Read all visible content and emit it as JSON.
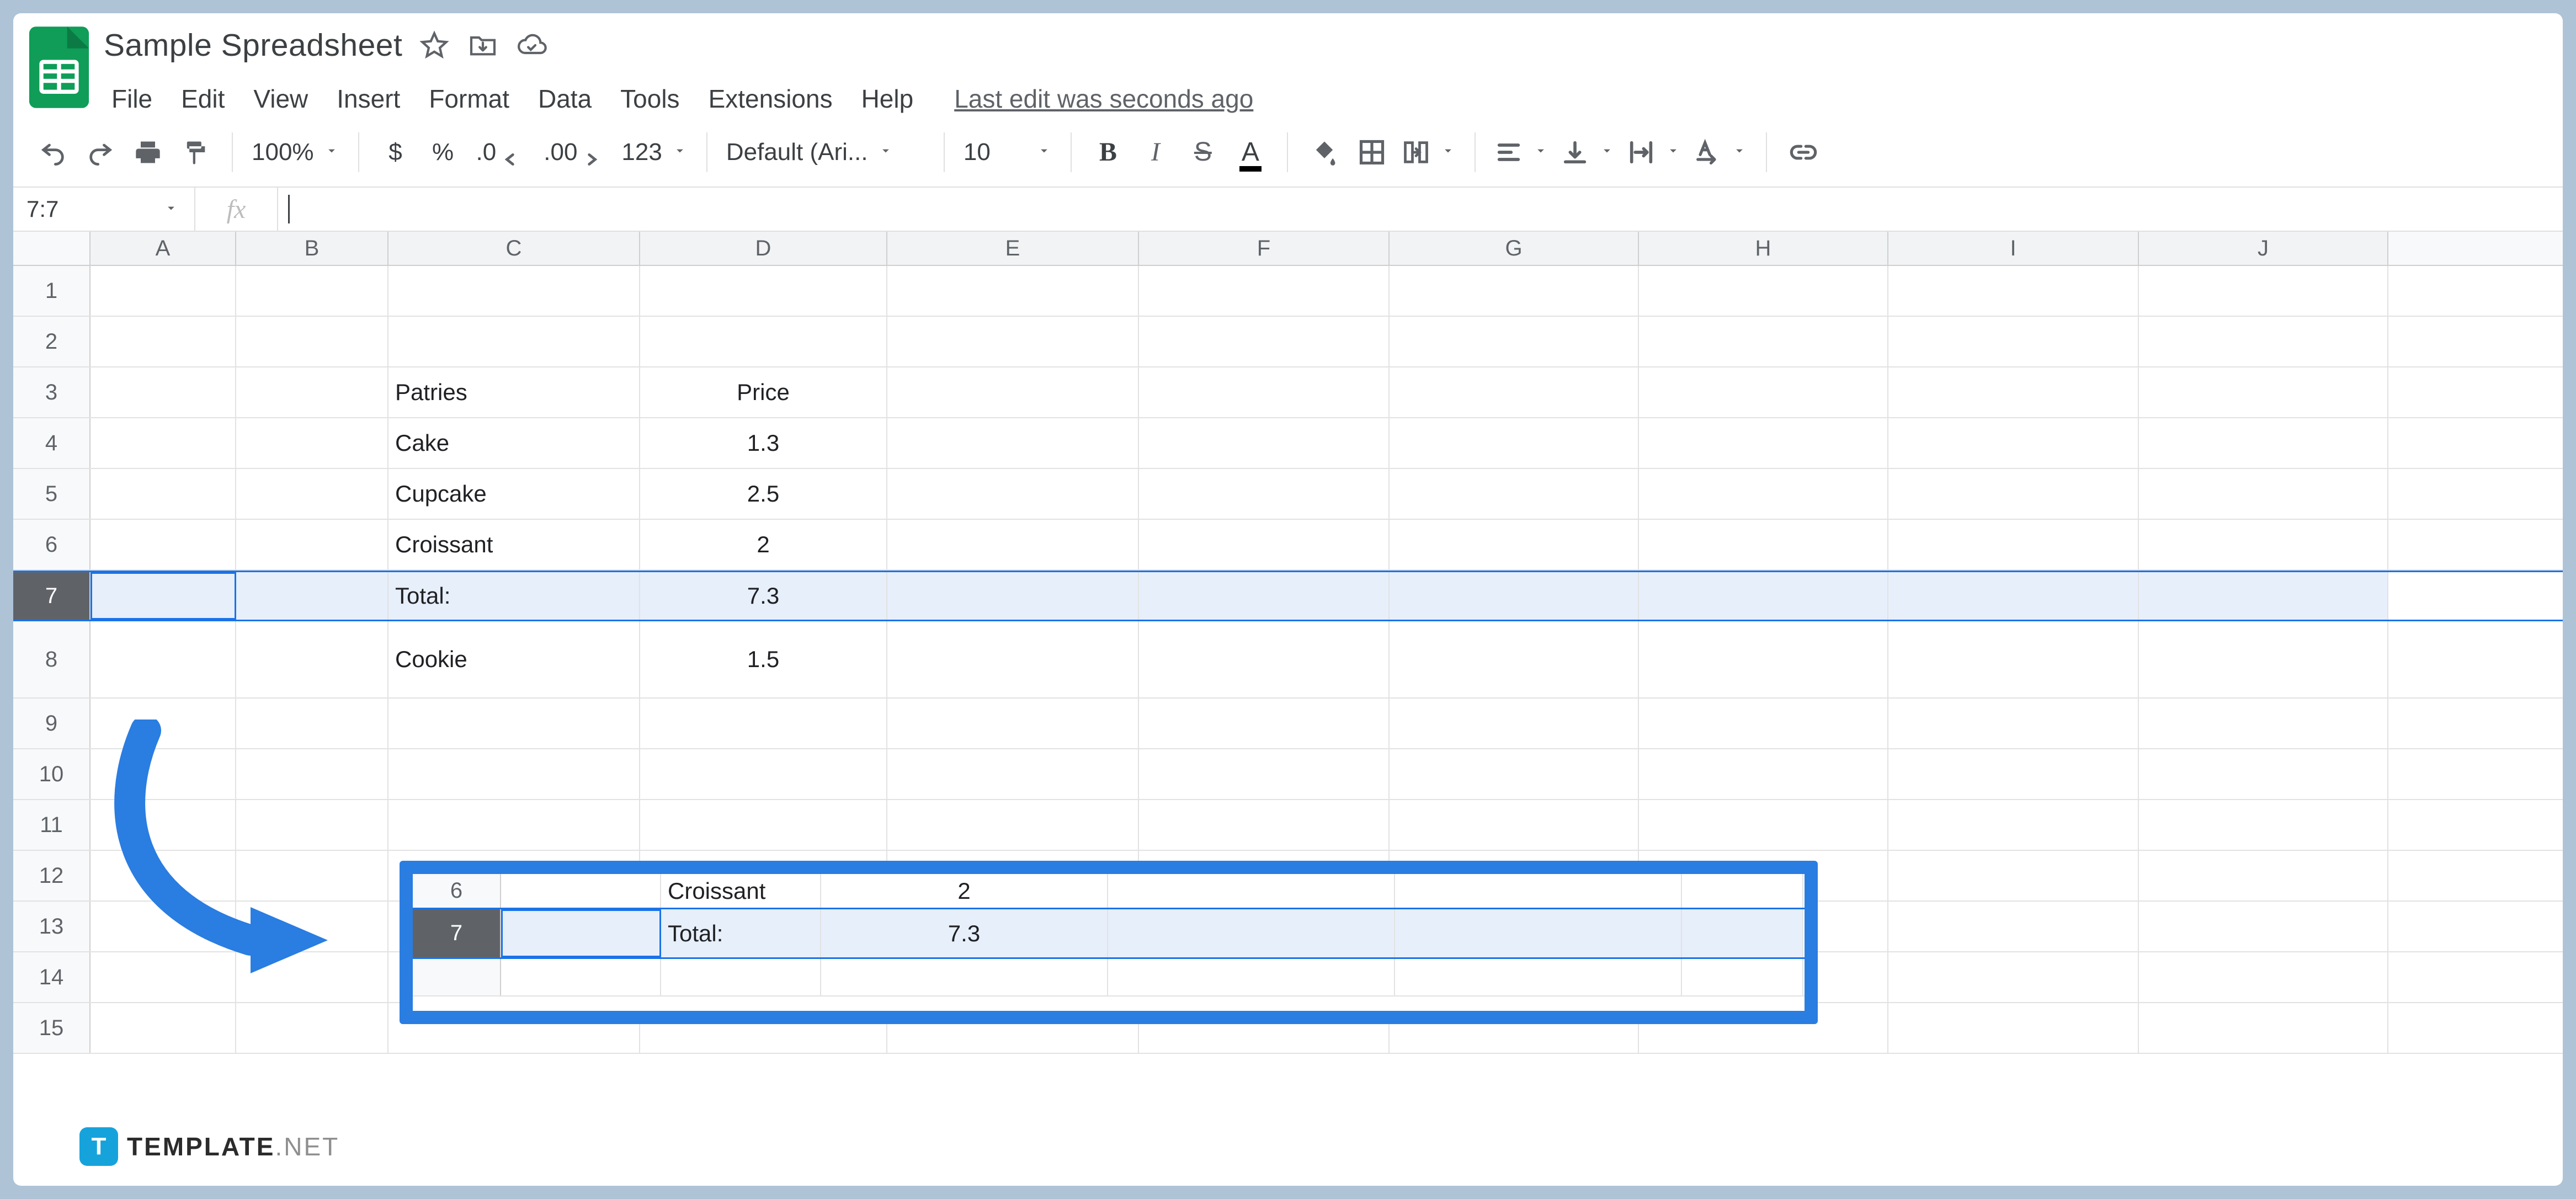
{
  "doc": {
    "title": "Sample Spreadsheet"
  },
  "menu": {
    "file": "File",
    "edit": "Edit",
    "view": "View",
    "insert": "Insert",
    "format": "Format",
    "data": "Data",
    "tools": "Tools",
    "extensions": "Extensions",
    "help": "Help",
    "edit_status": "Last edit was seconds ago"
  },
  "toolbar": {
    "zoom": "100%",
    "currency": "$",
    "percent": "%",
    "dec_dec": ".0",
    "inc_dec": ".00",
    "more_formats": "123",
    "font": "Default (Ari...",
    "font_size": "10",
    "bold": "B",
    "italic": "I",
    "strike": "S",
    "textcolor": "A"
  },
  "namebox": {
    "value": "7:7"
  },
  "fx": {
    "label": "fx"
  },
  "columns": [
    "A",
    "B",
    "C",
    "D",
    "E",
    "F",
    "G",
    "H",
    "I",
    "J"
  ],
  "rows": [
    "1",
    "2",
    "3",
    "4",
    "5",
    "6",
    "7",
    "8",
    "9",
    "10",
    "11",
    "12",
    "13",
    "14",
    "15"
  ],
  "cells": {
    "C3": "Patries",
    "D3": "Price",
    "C4": "Cake",
    "D4": "1.3",
    "C5": "Cupcake",
    "D5": "2.5",
    "C6": "Croissant",
    "D6": "2",
    "C7": "Total:",
    "D7": "7.3",
    "C8": "Cookie",
    "D8": "1.5"
  },
  "callout": {
    "r6": {
      "num": "6",
      "c": "Croissant",
      "d": "2"
    },
    "r7": {
      "num": "7",
      "c": "Total:",
      "d": "7.3"
    }
  },
  "watermark": {
    "badge": "T",
    "bold": "TEMPLATE",
    "light": ".NET"
  }
}
